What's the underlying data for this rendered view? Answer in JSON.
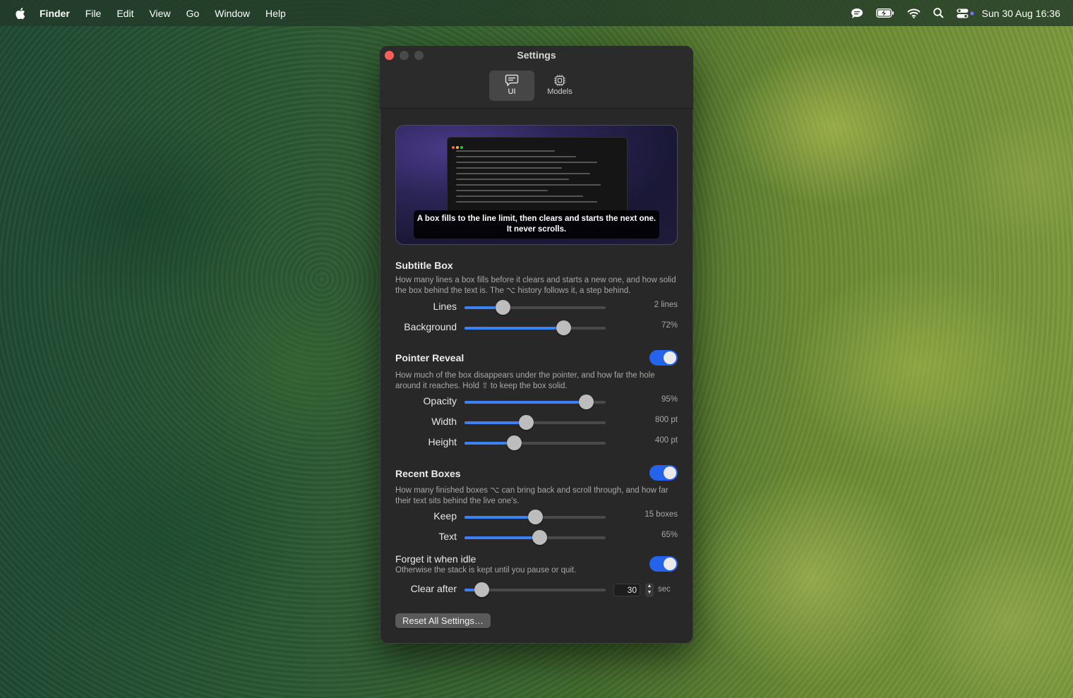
{
  "menubar": {
    "app_name": "Finder",
    "items": [
      "File",
      "Edit",
      "View",
      "Go",
      "Window",
      "Help"
    ],
    "clock": "Sun 30 Aug  16:36",
    "status_icons": [
      "messages-icon",
      "battery-icon",
      "wifi-icon",
      "spotlight-icon",
      "control-center-icon"
    ]
  },
  "window": {
    "title": "Settings",
    "tabs": [
      {
        "label": "UI",
        "icon": "speech-bubble-icon",
        "selected": true
      },
      {
        "label": "Models",
        "icon": "chip-icon",
        "selected": false
      }
    ],
    "preview": {
      "caption": "A box fills to the line limit, then clears and starts the next one. It never scrolls."
    },
    "subtitle_box": {
      "title": "Subtitle Box",
      "description": "How many lines a box fills before it clears and starts a new one, and how solid the box behind the text is. The ⌥ history follows it, a step behind.",
      "rows": [
        {
          "label": "Lines",
          "value": "2 lines",
          "fraction": 0.27
        },
        {
          "label": "Background",
          "value": "72%",
          "fraction": 0.7
        }
      ]
    },
    "pointer_reveal": {
      "title": "Pointer Reveal",
      "enabled": true,
      "description": "How much of the box disappears under the pointer, and how far the hole around it reaches. Hold ⇧ to keep the box solid.",
      "rows": [
        {
          "label": "Opacity",
          "value": "95%",
          "fraction": 0.86
        },
        {
          "label": "Width",
          "value": "800 pt",
          "fraction": 0.435
        },
        {
          "label": "Height",
          "value": "400 pt",
          "fraction": 0.35
        }
      ]
    },
    "recent_boxes": {
      "title": "Recent Boxes",
      "enabled": true,
      "description": "How many finished boxes ⌥ can bring back and scroll through, and how far their text sits behind the live one's.",
      "rows": [
        {
          "label": "Keep",
          "value": "15 boxes",
          "fraction": 0.5
        },
        {
          "label": "Text",
          "value": "65%",
          "fraction": 0.53
        }
      ]
    },
    "forget_idle": {
      "title": "Forget it when idle",
      "subtitle": "Otherwise the stack is kept until you pause or quit.",
      "enabled": true,
      "clear_label": "Clear after",
      "clear_value": "30",
      "clear_unit": "sec",
      "clear_fraction": 0.12
    },
    "reset_button": "Reset All Settings…"
  },
  "colors": {
    "accent": "#3b82f6",
    "toggle_on": "#2563eb",
    "close_button": "#ff5f57"
  }
}
